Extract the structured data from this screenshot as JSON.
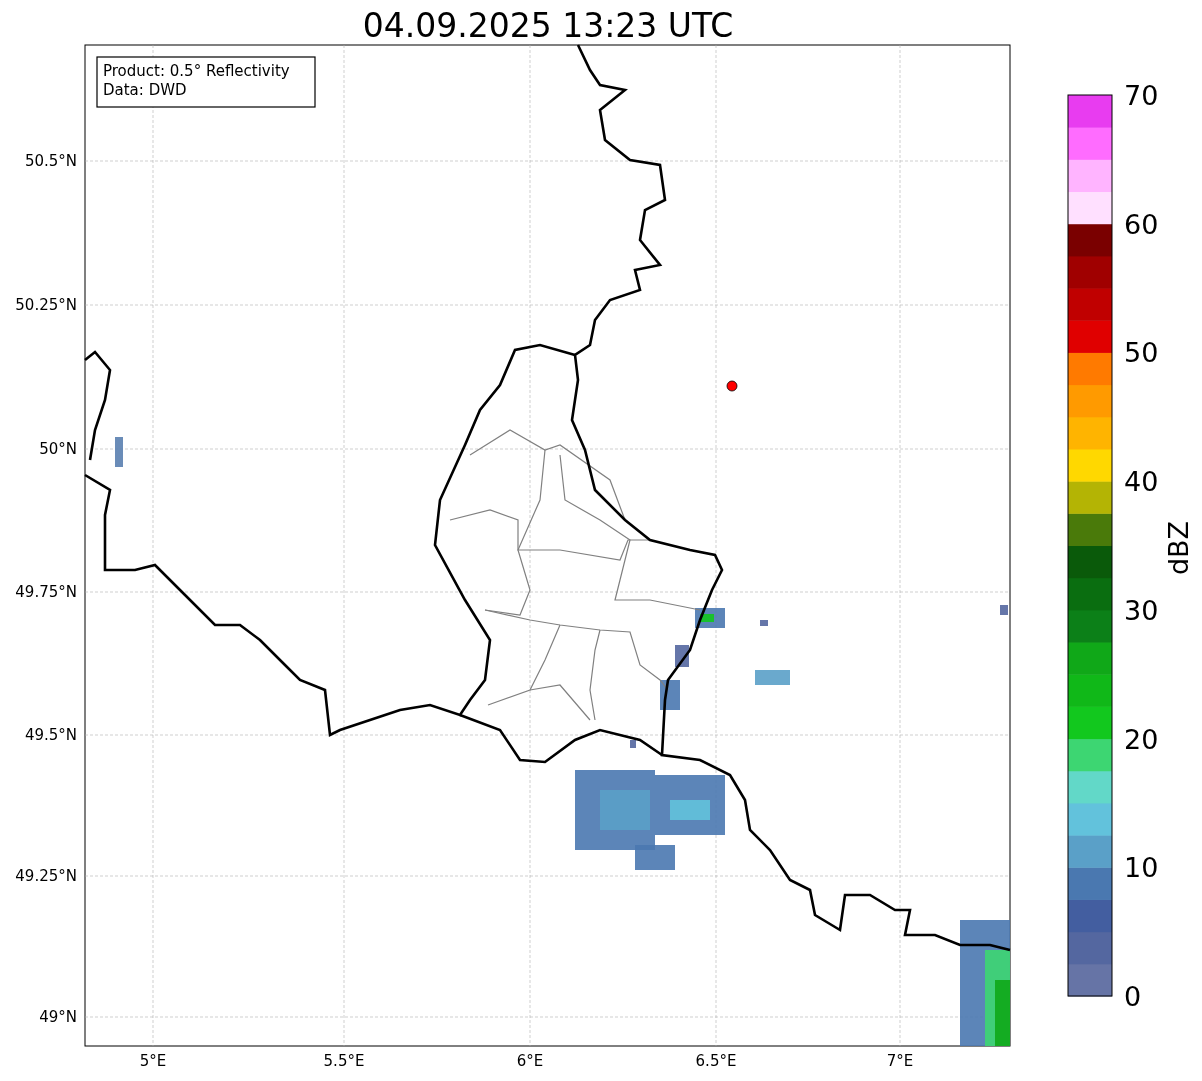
{
  "title": "04.09.2025 13:23 UTC",
  "info_box": {
    "lines": [
      "Product: 0.5° Reflectivity",
      "Data: DWD"
    ]
  },
  "x_ticks": [
    "5°E",
    "5.5°E",
    "6°E",
    "6.5°E",
    "7°E"
  ],
  "y_ticks": [
    "50.5°N",
    "50.25°N",
    "50°N",
    "49.75°N",
    "49.5°N",
    "49.25°N",
    "49°N"
  ],
  "colorbar": {
    "label": "dBZ",
    "ticks": [
      "70",
      "60",
      "50",
      "40",
      "30",
      "20",
      "10",
      "0"
    ]
  }
}
